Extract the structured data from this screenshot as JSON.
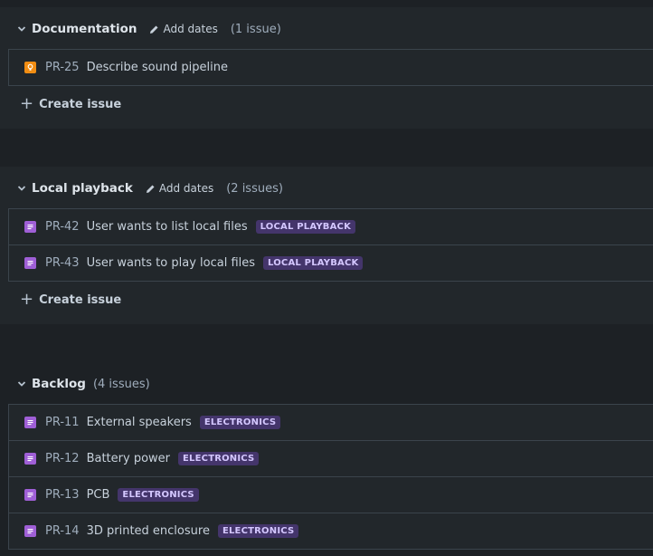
{
  "sections": [
    {
      "name": "Documentation",
      "add_dates_label": "Add dates",
      "count_label": "(1 issue)",
      "issues": [
        {
          "key": "PR-25",
          "summary": "Describe sound pipeline",
          "type": "idea",
          "epic": ""
        }
      ],
      "create_label": "Create issue"
    },
    {
      "name": "Local playback",
      "add_dates_label": "Add dates",
      "count_label": "(2 issues)",
      "issues": [
        {
          "key": "PR-42",
          "summary": "User wants to list local files",
          "type": "story",
          "epic": "LOCAL PLAYBACK"
        },
        {
          "key": "PR-43",
          "summary": "User wants to play local files",
          "type": "story",
          "epic": "LOCAL PLAYBACK"
        }
      ],
      "create_label": "Create issue"
    },
    {
      "name": "Backlog",
      "count_label": "(4 issues)",
      "issues": [
        {
          "key": "PR-11",
          "summary": "External speakers",
          "type": "story",
          "epic": "ELECTRONICS"
        },
        {
          "key": "PR-12",
          "summary": "Battery power",
          "type": "story",
          "epic": "ELECTRONICS"
        },
        {
          "key": "PR-13",
          "summary": "PCB",
          "type": "story",
          "epic": "ELECTRONICS"
        },
        {
          "key": "PR-14",
          "summary": "3D printed enclosure",
          "type": "story",
          "epic": "ELECTRONICS"
        }
      ]
    }
  ],
  "colors": {
    "background": "#1d2125",
    "panel": "#22272b",
    "border": "#3b444c",
    "idea_icon": "#f18d13",
    "story_icon": "#9f5fd6",
    "epic_lozenge_bg": "#44356b",
    "epic_lozenge_text": "#d4c7ff"
  },
  "icons": {
    "collapse": "chevron-down-icon",
    "edit": "pencil-icon",
    "idea": "lightbulb-icon",
    "story": "document-lines-icon",
    "create": "plus-icon"
  }
}
